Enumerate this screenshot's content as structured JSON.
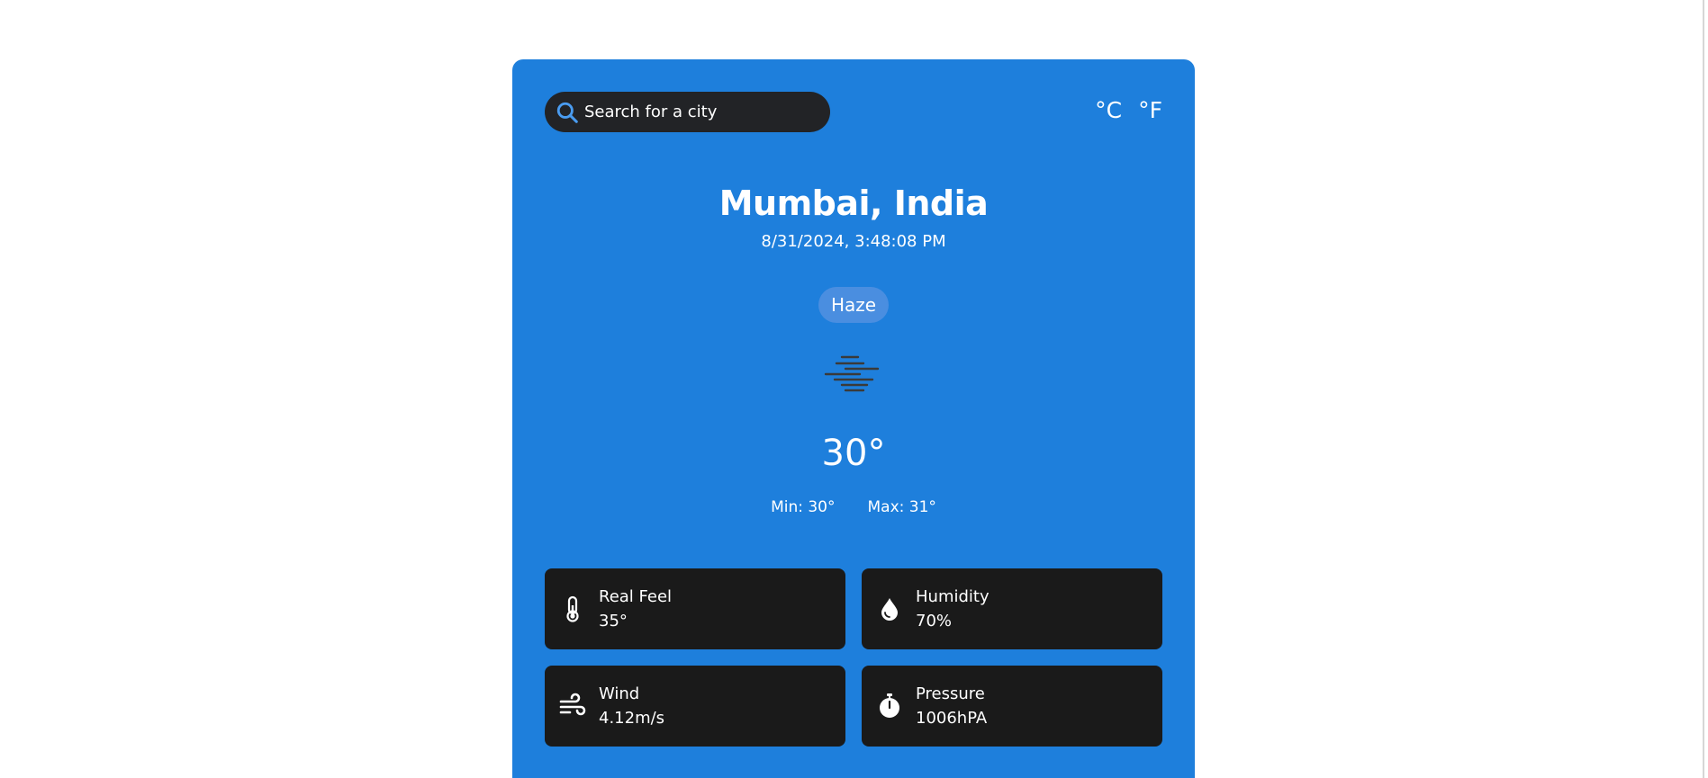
{
  "search": {
    "placeholder": "Search for a city",
    "icon": "search-icon"
  },
  "units": {
    "celsius": "°C",
    "fahrenheit": "°F"
  },
  "location": {
    "city": "Mumbai, India",
    "datetime": "8/31/2024, 3:48:08 PM"
  },
  "weather": {
    "condition": "Haze",
    "icon": "haze-icon",
    "temperature": "30°",
    "min": "Min: 30°",
    "max": "Max: 31°"
  },
  "details": [
    {
      "label": "Real Feel",
      "value": "35°",
      "icon": "thermometer-icon"
    },
    {
      "label": "Humidity",
      "value": "70%",
      "icon": "water-drop-icon"
    },
    {
      "label": "Wind",
      "value": "4.12m/s",
      "icon": "wind-icon"
    },
    {
      "label": "Pressure",
      "value": "1006hPA",
      "icon": "stopwatch-icon"
    }
  ],
  "colors": {
    "card": "#1e7fdc",
    "tile": "#1a1a1a",
    "search": "#222326",
    "accent": "#4a9cf0"
  }
}
